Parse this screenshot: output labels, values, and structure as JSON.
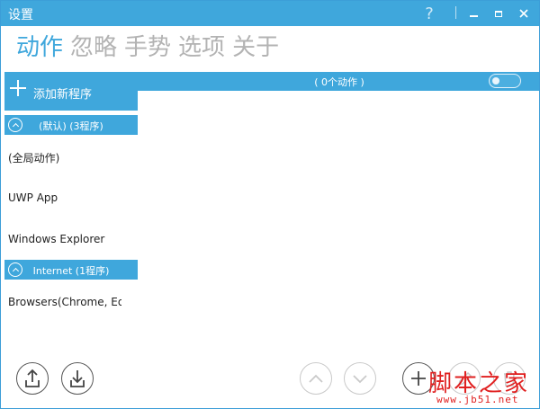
{
  "window": {
    "title": "设置"
  },
  "titlebar": {
    "help_icon": "question-icon",
    "minimize_icon": "minimize-icon",
    "maximize_icon": "maximize-icon",
    "close_icon": "close-icon"
  },
  "tabs": [
    {
      "label": "动作",
      "active": true
    },
    {
      "label": "忽略",
      "active": false
    },
    {
      "label": "手势",
      "active": false
    },
    {
      "label": "选项",
      "active": false
    },
    {
      "label": "关于",
      "active": false
    }
  ],
  "actions_header": {
    "count_text": "( 0个动作 )",
    "toggle_on": false
  },
  "sidebar": {
    "add_label": "添加新程序",
    "groups": [
      {
        "label": "(默认) (3程序)",
        "items": [
          "(全局动作)",
          "UWP App",
          "Windows Explorer"
        ]
      },
      {
        "label": "Internet (1程序)",
        "items": [
          "Browsers(Chrome, Edge"
        ]
      }
    ]
  },
  "bottom_buttons": [
    "upload-icon",
    "download-icon",
    "move-up-icon",
    "move-down-icon",
    "add-icon",
    "edit-icon",
    "delete-icon"
  ],
  "watermark": {
    "text": "脚本之家",
    "url": "www.jb51.net"
  },
  "colors": {
    "accent": "#3fa7dc",
    "tab_inactive": "#b3b3b3",
    "watermark": "#e02020"
  }
}
